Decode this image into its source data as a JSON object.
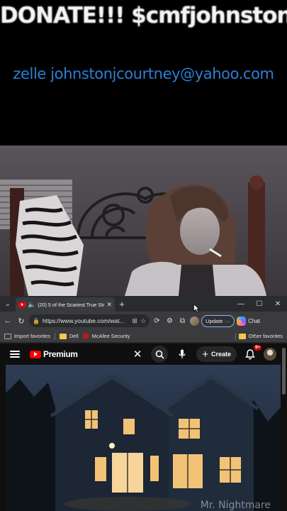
{
  "overlay": {
    "donate_text": "DONATE!!! $cmfjohnston",
    "zelle_text": "zelle johnstonjcourtney@yahoo.com"
  },
  "browser": {
    "tab": {
      "title": "(20) 5 of the Scariest True Sto",
      "icons": [
        "youtube-favicon",
        "speaker-icon",
        "close-icon"
      ]
    },
    "window_controls": [
      "minimize",
      "maximize",
      "close"
    ],
    "navbar": {
      "url": "https://www.youtube.com/wat...",
      "update_label": "Update",
      "chat_label": "Chat"
    },
    "favorites": {
      "items": [
        "Import favorites",
        "Dell",
        "McAfee Security"
      ],
      "other_label": "Other favorites"
    }
  },
  "youtube": {
    "brand": "Premium",
    "create_label": "Create",
    "notification_badge": "9+",
    "watermark": "Mr. Nightmare"
  },
  "colors": {
    "zelle_blue": "#2c7fd6",
    "youtube_red": "#ff0000",
    "browser_chrome": "#3b3b3e"
  }
}
